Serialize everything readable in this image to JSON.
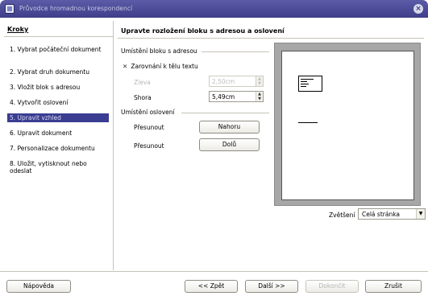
{
  "window": {
    "title": "Průvodce hromadnou korespondencí"
  },
  "steps": {
    "heading": "Kroky",
    "items": [
      {
        "label": "1. Vybrat počáteční dokument"
      },
      {
        "label": "2. Vybrat druh dokumentu"
      },
      {
        "label": "3. Vložit blok s adresou"
      },
      {
        "label": "4. Vytvořit oslovení"
      },
      {
        "label": "5. Upravit vzhled"
      },
      {
        "label": "6. Upravit dokument"
      },
      {
        "label": "7. Personalizace dokumentu"
      },
      {
        "label": "8. Uložit, vytisknout nebo odeslat"
      }
    ],
    "active_index": 4
  },
  "main": {
    "title": "Upravte rozložení bloku s adresou a oslovení",
    "address_section": {
      "label": "Umístění bloku s adresou",
      "align_checkbox": {
        "label": "Zarovnání k tělu textu",
        "checked": true
      },
      "left_label": "Zleva",
      "left_value": "2,50cm",
      "top_label": "Shora",
      "top_value": "5,49cm"
    },
    "salutation_section": {
      "label": "Umístění oslovení",
      "move_label_1": "Přesunout",
      "up_button": "Nahoru",
      "move_label_2": "Přesunout",
      "down_button": "Dolů"
    },
    "zoom": {
      "label": "Zvětšení",
      "value": "Celá stránka"
    }
  },
  "footer": {
    "help": "Nápověda",
    "back": "<< Zpět",
    "next": "Další >>",
    "finish": "Dokončit",
    "cancel": "Zrušit"
  },
  "colors": {
    "titlebar": "#4b4b98",
    "active_step": "#3a3d91",
    "preview_bg": "#a7a7a7"
  }
}
